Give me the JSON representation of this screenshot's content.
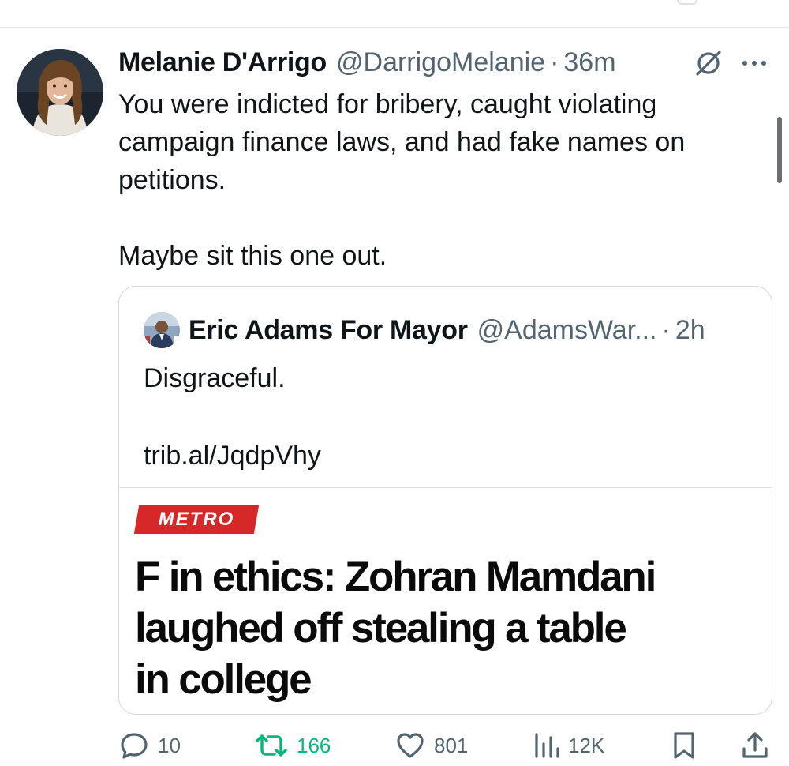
{
  "tweet": {
    "author_name": "Melanie D'Arrigo",
    "author_handle": "@DarrigoMelanie",
    "separator": "·",
    "time": "36m",
    "text_lines": [
      "You were indicted for bribery, caught violating",
      "campaign finance laws, and had fake names on",
      "petitions."
    ],
    "text_last": "Maybe sit this one out."
  },
  "quote": {
    "author_name": "Eric Adams For Mayor",
    "author_handle": "@AdamsWar...",
    "separator": "·",
    "time": "2h",
    "text": "Disgraceful.",
    "link": "trib.al/JqdpVhy",
    "article": {
      "section": "METRO",
      "headline_lines": [
        "F in ethics: Zohran Mamdani",
        "laughed off stealing a table",
        "in college"
      ]
    }
  },
  "actions": {
    "replies": "10",
    "reposts": "166",
    "likes": "801",
    "views": "12K"
  },
  "icons": {
    "reply": "reply-icon",
    "repost": "repost-icon",
    "like": "heart-icon",
    "views": "views-icon",
    "bookmark": "bookmark-icon",
    "share": "share-icon",
    "grok": "grok-icon",
    "more": "more-icon"
  },
  "colors": {
    "text": "#0f1419",
    "secondary": "#536471",
    "repost_active": "#00ba7c",
    "metro_red": "#d62828",
    "border": "#d0d6da"
  }
}
